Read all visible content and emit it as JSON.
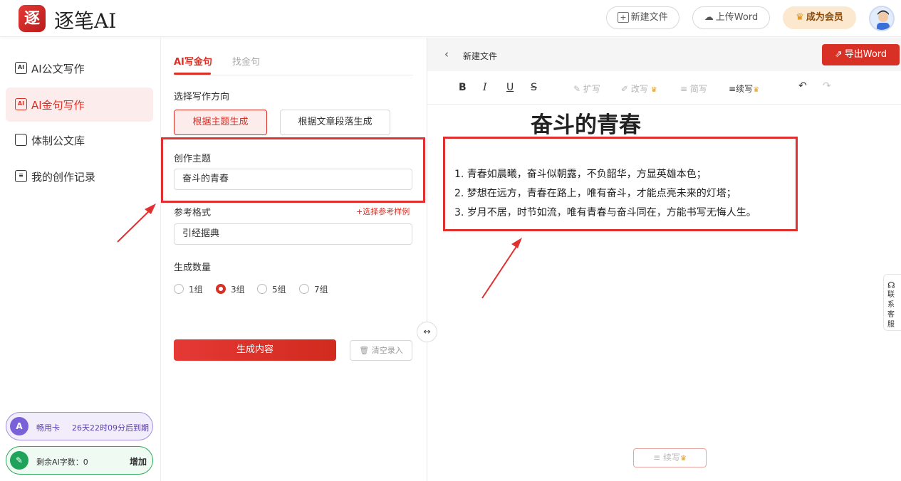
{
  "header": {
    "logo_mark": "逐",
    "brand": "逐笔AI",
    "new_file": "新建文件",
    "upload_word": "上传Word",
    "vip": "成为会员"
  },
  "sidebar": {
    "items": [
      {
        "label": "AI公文写作",
        "icon": "ai-doc-icon",
        "active": false
      },
      {
        "label": "AI金句写作",
        "icon": "ai-quote-icon",
        "active": true
      },
      {
        "label": "体制公文库",
        "icon": "folder-icon",
        "active": false
      },
      {
        "label": "我的创作记录",
        "icon": "record-icon",
        "active": false
      }
    ],
    "card": {
      "name": "畅用卡",
      "expire": "26天22时09分后到期"
    },
    "quota": {
      "label": "剩余AI字数：0",
      "action": "增加"
    }
  },
  "form": {
    "tabs": [
      "AI写金句",
      "找金句"
    ],
    "direction_label": "选择写作方向",
    "direction_options": [
      "根据主题生成",
      "根据文章段落生成"
    ],
    "topic_label": "创作主题",
    "topic_value": "奋斗的青春",
    "ref_label": "参考格式",
    "ref_pick": "+选择参考样例",
    "ref_value": "引经据典",
    "count_label": "生成数量",
    "count_options": [
      "1组",
      "3组",
      "5组",
      "7组"
    ],
    "count_selected": "3组",
    "generate": "生成内容",
    "clear": "清空录入"
  },
  "editor": {
    "doc_name": "新建文件",
    "export": "导出Word",
    "toolbar": {
      "bold": "B",
      "italic": "I",
      "underline": "U",
      "strike": "S",
      "expand": "扩写",
      "rewrite": "改写",
      "simplify": "简写",
      "continue": "续写"
    },
    "title": "奋斗的青春",
    "lines": [
      "1. 青春如晨曦，奋斗似朝露，不负韶华，方显英雄本色；",
      "2. 梦想在远方，青春在路上，唯有奋斗，才能点亮未来的灯塔；",
      "3. 岁月不居，时节如流，唯有青春与奋斗同在，方能书写无悔人生。"
    ],
    "continue_btn": "续写",
    "service": "联系客服"
  },
  "colors": {
    "accent": "#d93025",
    "vip_bg": "#fbe8cf",
    "card": "#7b61d9",
    "quota": "#1fa35a"
  }
}
